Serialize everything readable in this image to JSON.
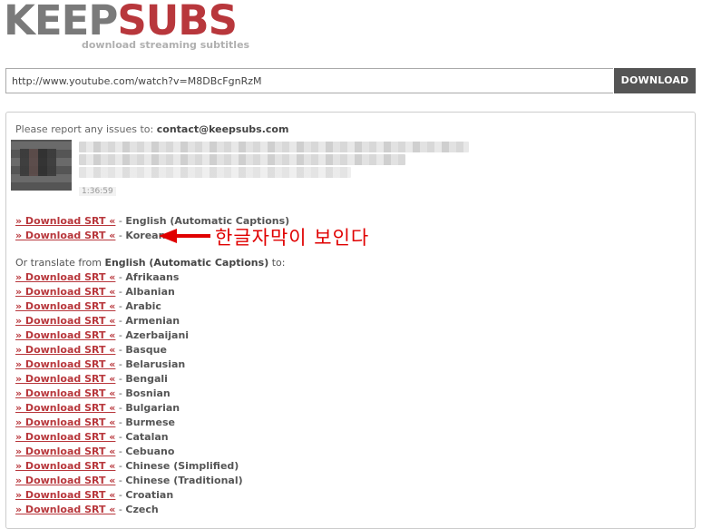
{
  "header": {
    "logo_part1": "KEEP",
    "logo_part2": "SUBS",
    "tagline": "download streaming subtitles",
    "logo_colors": {
      "keep": "#7a7a7a",
      "subs": "#b8373c"
    }
  },
  "url_bar": {
    "value": "http://www.youtube.com/watch?v=M8DBcFgnRzM",
    "button_label": "DOWNLOAD"
  },
  "panel": {
    "report_prefix": "Please report any issues to: ",
    "report_email": "contact@keepsubs.com",
    "video_duration": "1:36:59",
    "link_label": "» Download SRT «",
    "separator": " - ",
    "primary_captions": [
      "English (Automatic Captions)",
      "Korean"
    ],
    "translate_prefix": "Or translate from ",
    "translate_source": "English (Automatic Captions)",
    "translate_suffix": " to:",
    "translations": [
      "Afrikaans",
      "Albanian",
      "Arabic",
      "Armenian",
      "Azerbaijani",
      "Basque",
      "Belarusian",
      "Bengali",
      "Bosnian",
      "Bulgarian",
      "Burmese",
      "Catalan",
      "Cebuano",
      "Chinese (Simplified)",
      "Chinese (Traditional)",
      "Croatian",
      "Czech"
    ]
  },
  "annotation": {
    "text": "한글자막이 보인다",
    "color": "#e00000"
  }
}
